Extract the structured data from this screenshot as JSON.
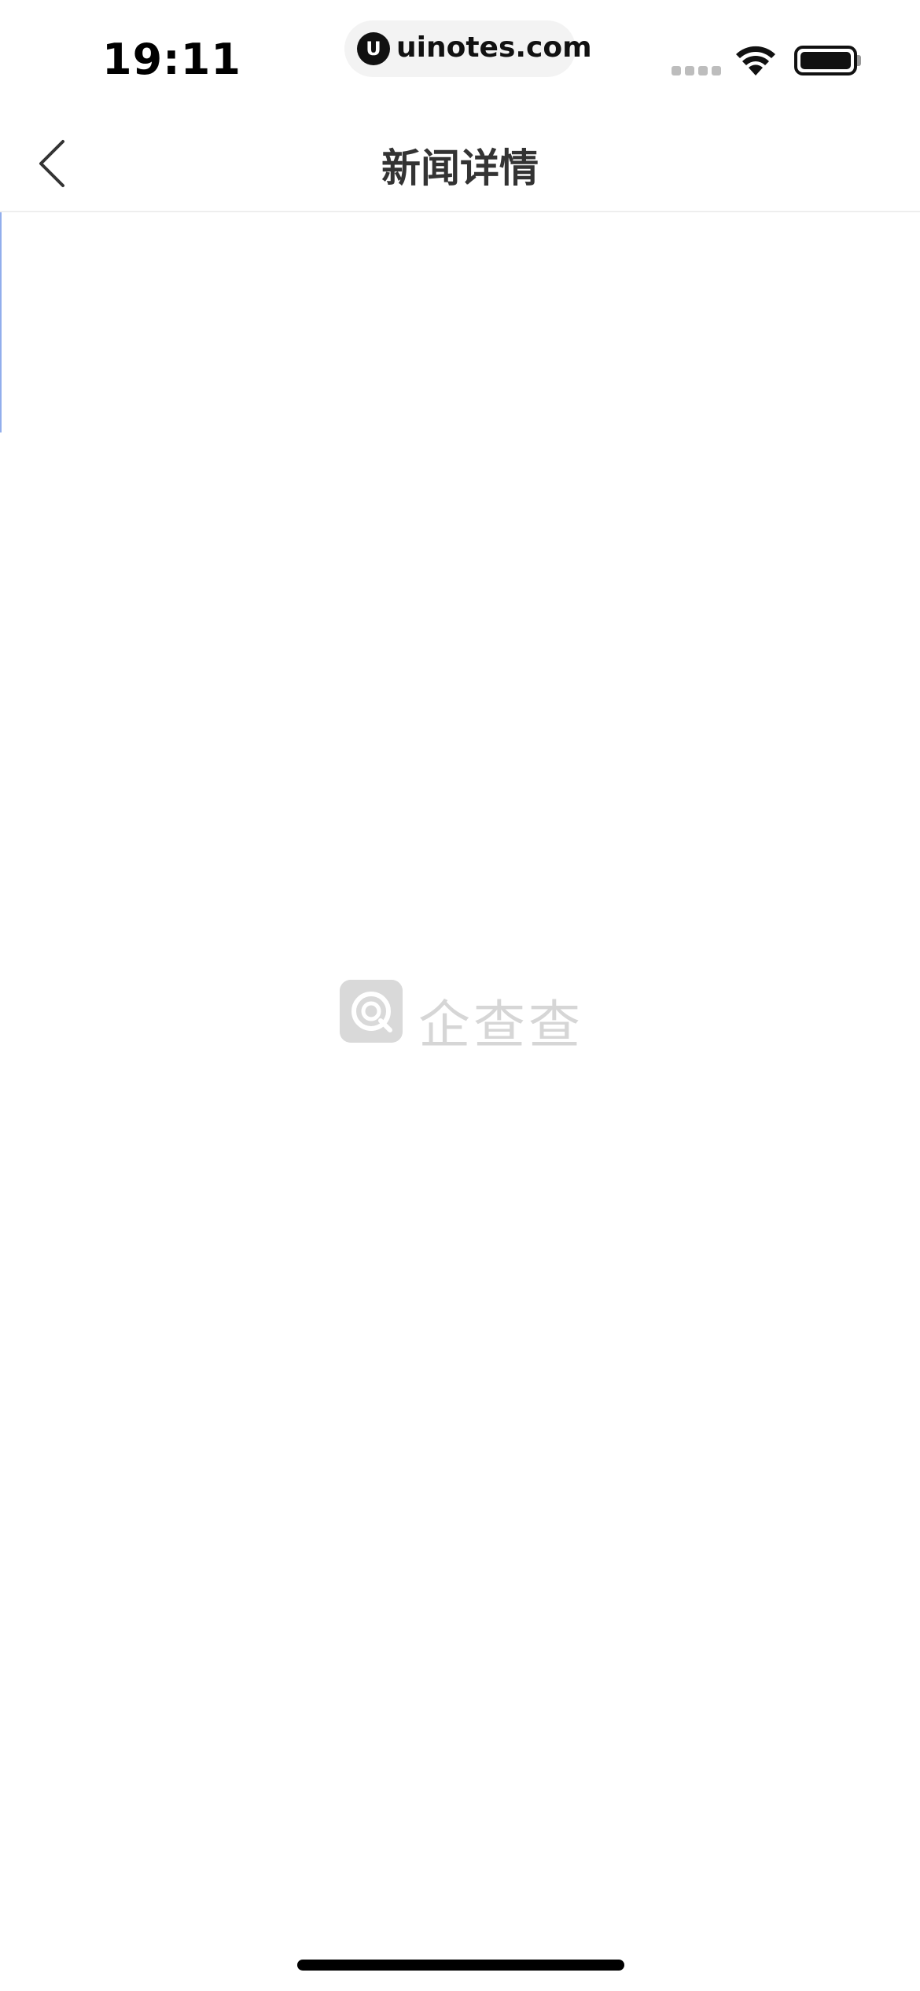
{
  "status_bar": {
    "time": "19:11",
    "url": "uinotes.com",
    "url_logo_glyph": "U"
  },
  "nav": {
    "title": "新闻详情",
    "back_icon": "chevron-left-icon"
  },
  "content": {
    "watermark_text": "企查查",
    "watermark_icon": "qcc-logo-icon"
  },
  "colors": {
    "background": "#ffffff",
    "title_text": "#333333",
    "divider": "#eeeeee",
    "watermark": "#d6d6d6"
  }
}
